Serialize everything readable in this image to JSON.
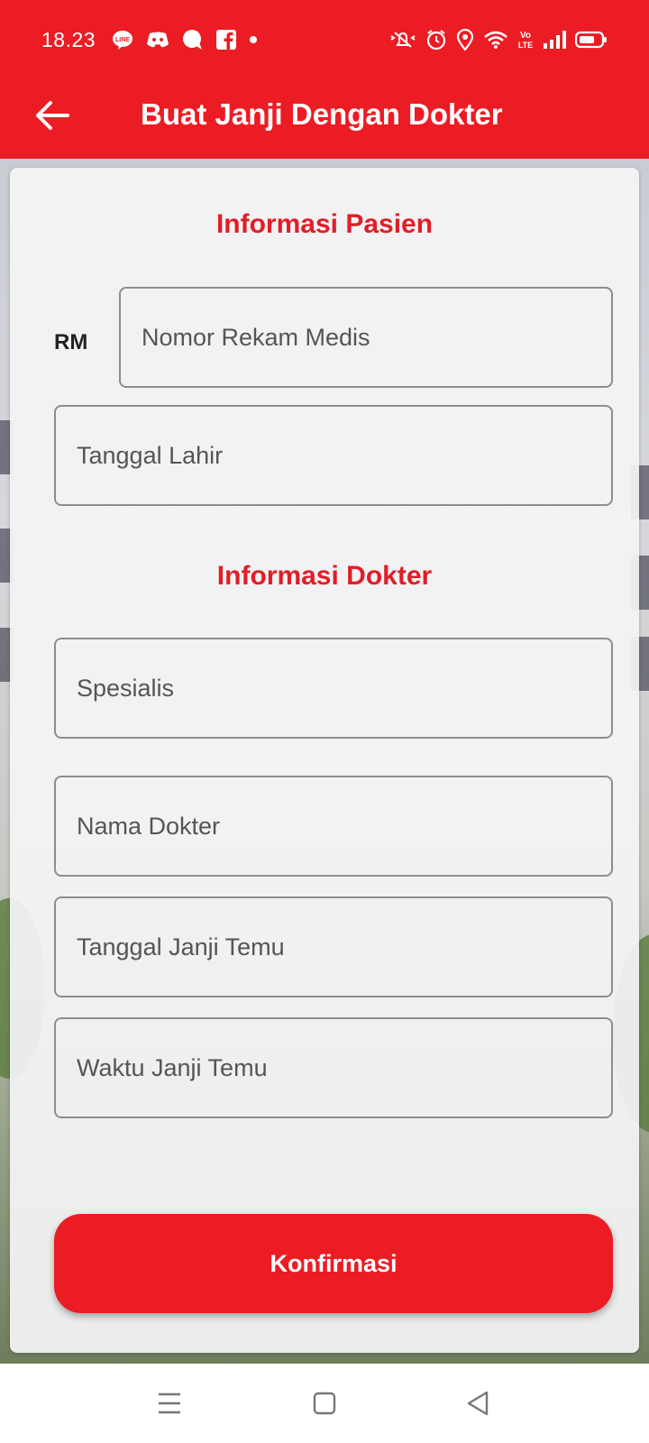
{
  "status": {
    "time": "18.23",
    "left_icons": [
      "line-icon",
      "discord-icon",
      "messenger-icon",
      "facebook-icon",
      "dot-icon"
    ],
    "right_icons": [
      "mute-icon",
      "alarm-icon",
      "location-icon",
      "wifi-icon",
      "volte-icon",
      "signal-icon",
      "battery-icon"
    ]
  },
  "appbar": {
    "title": "Buat Janji Dengan Dokter",
    "back_icon": "arrow-left-icon"
  },
  "patient": {
    "section_title": "Informasi Pasien",
    "rm_label": "RM",
    "rm_placeholder": "Nomor Rekam Medis",
    "dob_placeholder": "Tanggal Lahir"
  },
  "doctor": {
    "section_title": "Informasi Dokter",
    "specialist_placeholder": "Spesialis",
    "doctor_name_placeholder": "Nama Dokter",
    "date_placeholder": "Tanggal Janji Temu",
    "time_placeholder": "Waktu Janji Temu"
  },
  "confirm_label": "Konfirmasi",
  "navbar": {
    "icons": [
      "menu-icon",
      "home-square-icon",
      "back-triangle-icon"
    ]
  },
  "colors": {
    "brand_red": "#ec1c24",
    "section_title_red": "#e01e27"
  }
}
